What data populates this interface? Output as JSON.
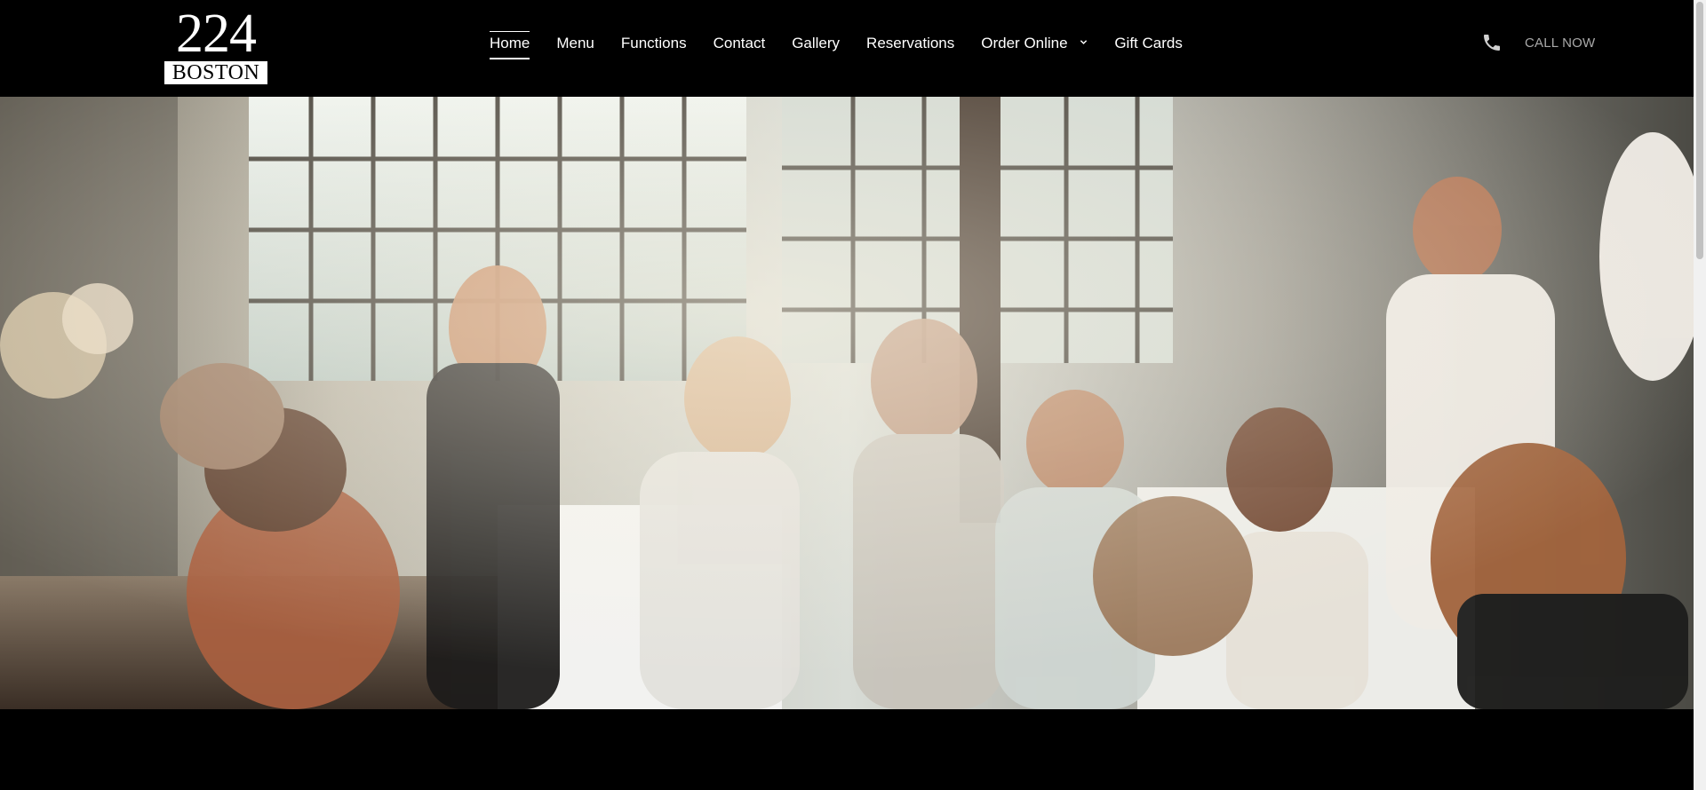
{
  "logo": {
    "number": "224",
    "word": "BOSTON"
  },
  "nav": {
    "items": [
      {
        "label": "Home"
      },
      {
        "label": "Menu"
      },
      {
        "label": "Functions"
      },
      {
        "label": "Contact"
      },
      {
        "label": "Gallery"
      },
      {
        "label": "Reservations"
      },
      {
        "label": "Order Online"
      },
      {
        "label": "Gift Cards"
      }
    ],
    "active_item": "Home"
  },
  "call": {
    "icon": "phone-icon",
    "label": "CALL NOW"
  },
  "hero": {
    "image": "restaurant-dining-room-photo"
  },
  "colors": {
    "header_bg": "#000000",
    "call_text": "#a9a9a9",
    "nav_text": "#ffffff"
  }
}
